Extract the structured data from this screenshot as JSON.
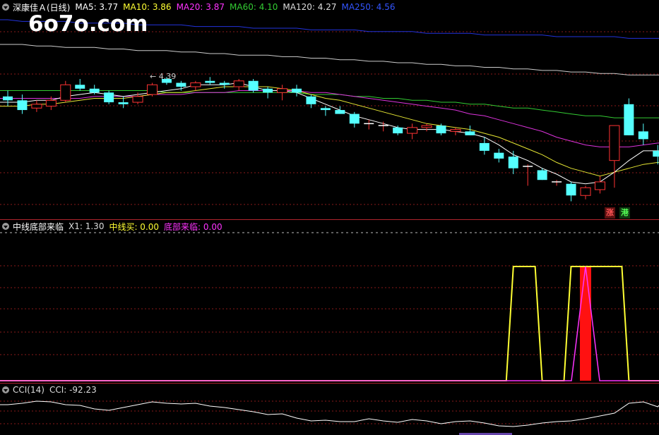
{
  "main": {
    "stock_name": "深康佳Ａ(日线)",
    "ma": [
      {
        "label": "MA5: 3.77",
        "color": "#ffffff"
      },
      {
        "label": "MA10: 3.86",
        "color": "#ffff33"
      },
      {
        "label": "MA20: 3.87",
        "color": "#ff33ff"
      },
      {
        "label": "MA60: 4.10",
        "color": "#33cc33"
      },
      {
        "label": "MA120: 4.27",
        "color": "#dddddd"
      },
      {
        "label": "MA250: 4.56",
        "color": "#3355ff"
      }
    ],
    "high_label": "4.39",
    "watermark": "6o7o.com",
    "badges": [
      {
        "text": "涨",
        "color": "#ff5555",
        "bg": "#5a1010"
      },
      {
        "text": "港",
        "color": "#55ff55",
        "bg": "#103a10"
      }
    ]
  },
  "indicator": {
    "name": "中线底部来临",
    "params": [
      {
        "label": "X1: 1.30",
        "color": "#dddddd"
      },
      {
        "label": "中线买: 0.00",
        "color": "#ffff33"
      },
      {
        "label": "底部来临: 0.00",
        "color": "#ff33ff"
      }
    ]
  },
  "cci": {
    "name": "CCI(14)",
    "value_label": "CCI: -92.23"
  },
  "colors": {
    "up": "#ff3333",
    "down": "#55ffff",
    "grid": "#8a1a1a",
    "separator": "#b0242e"
  },
  "candles": [
    [
      4.3,
      4.33,
      4.25,
      4.28
    ],
    [
      4.28,
      4.31,
      4.21,
      4.23
    ],
    [
      4.24,
      4.28,
      4.22,
      4.26
    ],
    [
      4.25,
      4.3,
      4.23,
      4.28
    ],
    [
      4.28,
      4.38,
      4.27,
      4.36
    ],
    [
      4.36,
      4.39,
      4.33,
      4.34
    ],
    [
      4.34,
      4.36,
      4.31,
      4.32
    ],
    [
      4.32,
      4.33,
      4.26,
      4.27
    ],
    [
      4.27,
      4.3,
      4.24,
      4.26
    ],
    [
      4.27,
      4.32,
      4.26,
      4.3
    ],
    [
      4.31,
      4.37,
      4.3,
      4.36
    ],
    [
      4.39,
      4.4,
      4.36,
      4.37
    ],
    [
      4.37,
      4.38,
      4.33,
      4.35
    ],
    [
      4.35,
      4.38,
      4.33,
      4.37
    ],
    [
      4.38,
      4.4,
      4.36,
      4.37
    ],
    [
      4.37,
      4.38,
      4.34,
      4.36
    ],
    [
      4.35,
      4.39,
      4.33,
      4.38
    ],
    [
      4.38,
      4.39,
      4.32,
      4.33
    ],
    [
      4.34,
      4.35,
      4.29,
      4.32
    ],
    [
      4.32,
      4.36,
      4.28,
      4.34
    ],
    [
      4.34,
      4.36,
      4.3,
      4.32
    ],
    [
      4.3,
      4.31,
      4.24,
      4.26
    ],
    [
      4.24,
      4.25,
      4.2,
      4.23
    ],
    [
      4.23,
      4.25,
      4.21,
      4.21
    ],
    [
      4.21,
      4.22,
      4.14,
      4.16
    ],
    [
      4.16,
      4.18,
      4.13,
      4.16
    ],
    [
      4.15,
      4.17,
      4.12,
      4.15
    ],
    [
      4.14,
      4.15,
      4.1,
      4.11
    ],
    [
      4.11,
      4.16,
      4.08,
      4.14
    ],
    [
      4.14,
      4.16,
      4.12,
      4.15
    ],
    [
      4.15,
      4.16,
      4.1,
      4.11
    ],
    [
      4.12,
      4.14,
      4.1,
      4.13
    ],
    [
      4.12,
      4.15,
      4.1,
      4.1
    ],
    [
      4.06,
      4.09,
      4.0,
      4.02
    ],
    [
      4.01,
      4.03,
      3.96,
      3.98
    ],
    [
      3.99,
      4.02,
      3.9,
      3.93
    ],
    [
      3.94,
      3.95,
      3.84,
      3.94
    ],
    [
      3.92,
      3.93,
      3.87,
      3.87
    ],
    [
      3.86,
      3.87,
      3.84,
      3.86
    ],
    [
      3.85,
      3.86,
      3.76,
      3.79
    ],
    [
      3.79,
      3.84,
      3.77,
      3.83
    ],
    [
      3.82,
      3.89,
      3.8,
      3.86
    ],
    [
      3.97,
      4.15,
      3.83,
      4.15
    ],
    [
      4.26,
      4.29,
      4.1,
      4.1
    ],
    [
      4.12,
      4.16,
      4.05,
      4.08
    ],
    [
      4.02,
      4.05,
      3.95,
      3.99
    ]
  ],
  "ma_lines": {
    "ma5": [
      4.27,
      4.27,
      4.28,
      4.28,
      4.3,
      4.31,
      4.32,
      4.31,
      4.3,
      4.31,
      4.32,
      4.33,
      4.34,
      4.36,
      4.36,
      4.36,
      4.37,
      4.35,
      4.33,
      4.33,
      4.32,
      4.29,
      4.26,
      4.23,
      4.2,
      4.18,
      4.16,
      4.14,
      4.13,
      4.13,
      4.13,
      4.12,
      4.11,
      4.09,
      4.05,
      4.0,
      3.97,
      3.93,
      3.9,
      3.86,
      3.85,
      3.86,
      3.91,
      3.97,
      4.02,
      4.02
    ],
    "ma10": [
      4.25,
      4.25,
      4.26,
      4.26,
      4.27,
      4.28,
      4.29,
      4.29,
      4.29,
      4.3,
      4.31,
      4.32,
      4.32,
      4.33,
      4.34,
      4.35,
      4.35,
      4.35,
      4.35,
      4.34,
      4.33,
      4.31,
      4.29,
      4.28,
      4.26,
      4.24,
      4.22,
      4.2,
      4.18,
      4.16,
      4.15,
      4.14,
      4.13,
      4.11,
      4.09,
      4.06,
      4.03,
      4.0,
      3.96,
      3.93,
      3.91,
      3.89,
      3.91,
      3.93,
      3.95,
      3.96
    ],
    "ma20": [
      4.29,
      4.29,
      4.29,
      4.29,
      4.29,
      4.29,
      4.3,
      4.3,
      4.3,
      4.3,
      4.31,
      4.31,
      4.31,
      4.32,
      4.32,
      4.32,
      4.33,
      4.33,
      4.33,
      4.33,
      4.33,
      4.32,
      4.32,
      4.31,
      4.3,
      4.29,
      4.28,
      4.27,
      4.26,
      4.25,
      4.24,
      4.23,
      4.21,
      4.2,
      4.18,
      4.16,
      4.14,
      4.12,
      4.09,
      4.07,
      4.05,
      4.04,
      4.04,
      4.04,
      4.05,
      4.06
    ],
    "ma60": [
      4.33,
      4.33,
      4.33,
      4.33,
      4.33,
      4.33,
      4.33,
      4.33,
      4.33,
      4.33,
      4.33,
      4.32,
      4.32,
      4.32,
      4.32,
      4.32,
      4.32,
      4.32,
      4.32,
      4.32,
      4.32,
      4.31,
      4.31,
      4.31,
      4.3,
      4.3,
      4.29,
      4.29,
      4.28,
      4.28,
      4.27,
      4.27,
      4.26,
      4.26,
      4.25,
      4.24,
      4.24,
      4.23,
      4.22,
      4.21,
      4.2,
      4.2,
      4.19,
      4.19,
      4.19,
      4.19
    ],
    "ma120": [
      4.56,
      4.56,
      4.55,
      4.55,
      4.54,
      4.54,
      4.54,
      4.53,
      4.53,
      4.52,
      4.52,
      4.52,
      4.51,
      4.51,
      4.5,
      4.5,
      4.49,
      4.49,
      4.49,
      4.48,
      4.48,
      4.47,
      4.47,
      4.46,
      4.46,
      4.45,
      4.45,
      4.44,
      4.44,
      4.43,
      4.43,
      4.42,
      4.42,
      4.41,
      4.41,
      4.4,
      4.4,
      4.39,
      4.39,
      4.38,
      4.38,
      4.37,
      4.37,
      4.36,
      4.36,
      4.36
    ],
    "ma250": [
      4.77,
      4.76,
      4.76,
      4.76,
      4.76,
      4.75,
      4.75,
      4.75,
      4.75,
      4.74,
      4.74,
      4.74,
      4.74,
      4.73,
      4.73,
      4.73,
      4.73,
      4.72,
      4.72,
      4.72,
      4.72,
      4.71,
      4.71,
      4.71,
      4.71,
      4.7,
      4.7,
      4.7,
      4.7,
      4.69,
      4.69,
      4.69,
      4.69,
      4.68,
      4.68,
      4.68,
      4.68,
      4.68,
      4.67,
      4.67,
      4.67,
      4.67,
      4.67,
      4.66,
      4.66,
      4.66
    ]
  },
  "buy_signal": [
    0,
    0,
    0,
    0,
    0,
    0,
    0,
    0,
    0,
    0,
    0,
    0,
    0,
    0,
    0,
    0,
    0,
    0,
    0,
    0,
    0,
    0,
    0,
    0,
    0,
    0,
    0,
    0,
    0,
    0,
    0,
    0,
    0,
    0,
    0,
    1,
    1,
    0,
    0,
    1,
    1,
    1,
    1,
    0,
    0,
    0
  ],
  "bottom_signal": [
    0,
    0,
    0,
    0,
    0,
    0,
    0,
    0,
    0,
    0,
    0,
    0,
    0,
    0,
    0,
    0,
    0,
    0,
    0,
    0,
    0,
    0,
    0,
    0,
    0,
    0,
    0,
    0,
    0,
    0,
    0,
    0,
    0,
    0,
    0,
    0,
    0,
    0,
    0,
    0,
    1,
    0,
    0,
    0,
    0,
    0
  ],
  "cci_values": [
    60,
    70,
    85,
    80,
    60,
    55,
    30,
    20,
    40,
    60,
    80,
    70,
    65,
    70,
    50,
    40,
    25,
    10,
    -10,
    -5,
    -35,
    -55,
    -50,
    -60,
    -60,
    -40,
    -55,
    -65,
    -45,
    -55,
    -75,
    -60,
    -55,
    -70,
    -90,
    -95,
    -85,
    -70,
    -60,
    -55,
    -40,
    -20,
    0,
    70,
    80,
    45
  ]
}
